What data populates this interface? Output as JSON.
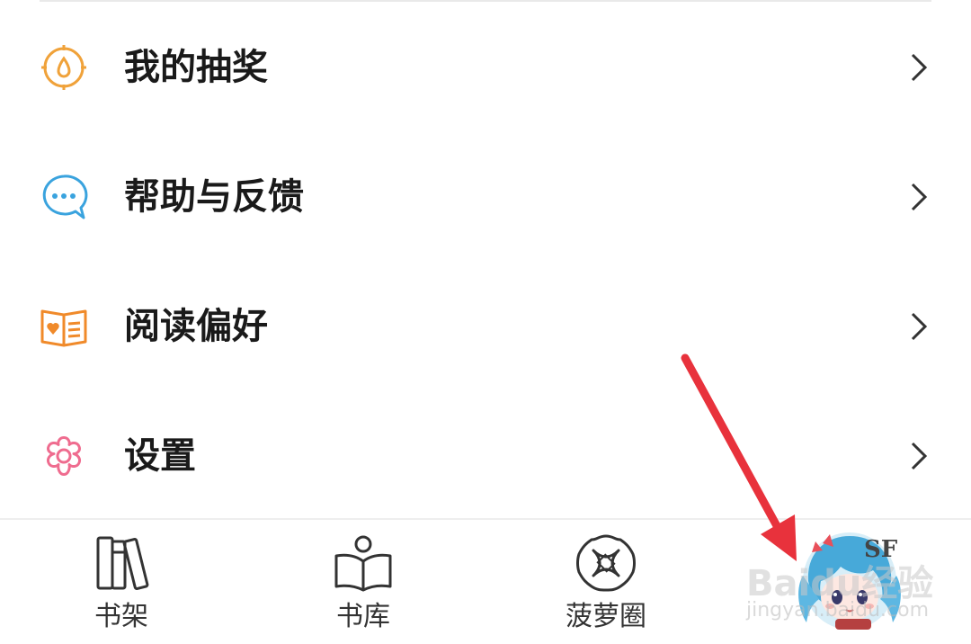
{
  "menu": {
    "items": [
      {
        "label": "我的抽奖",
        "icon": "lottery-compass-icon",
        "color": "#f0a23a"
      },
      {
        "label": "帮助与反馈",
        "icon": "chat-bubble-icon",
        "color": "#3aa3de"
      },
      {
        "label": "阅读偏好",
        "icon": "open-book-heart-icon",
        "color": "#f08a2a"
      },
      {
        "label": "设置",
        "icon": "gear-flower-icon",
        "color": "#ef6c8f"
      }
    ]
  },
  "tabbar": {
    "tabs": [
      {
        "label": "书架",
        "icon": "bookshelf-icon"
      },
      {
        "label": "书库",
        "icon": "library-reader-icon"
      },
      {
        "label": "菠萝圈",
        "icon": "pineapple-circle-icon"
      }
    ],
    "profile": {
      "icon": "profile-avatar-icon",
      "badge": "SF"
    }
  },
  "overlay": {
    "watermark": {
      "title": "Baidu经验",
      "url": "jingyan.baidu.com"
    },
    "arrow_color": "#e8323c"
  }
}
